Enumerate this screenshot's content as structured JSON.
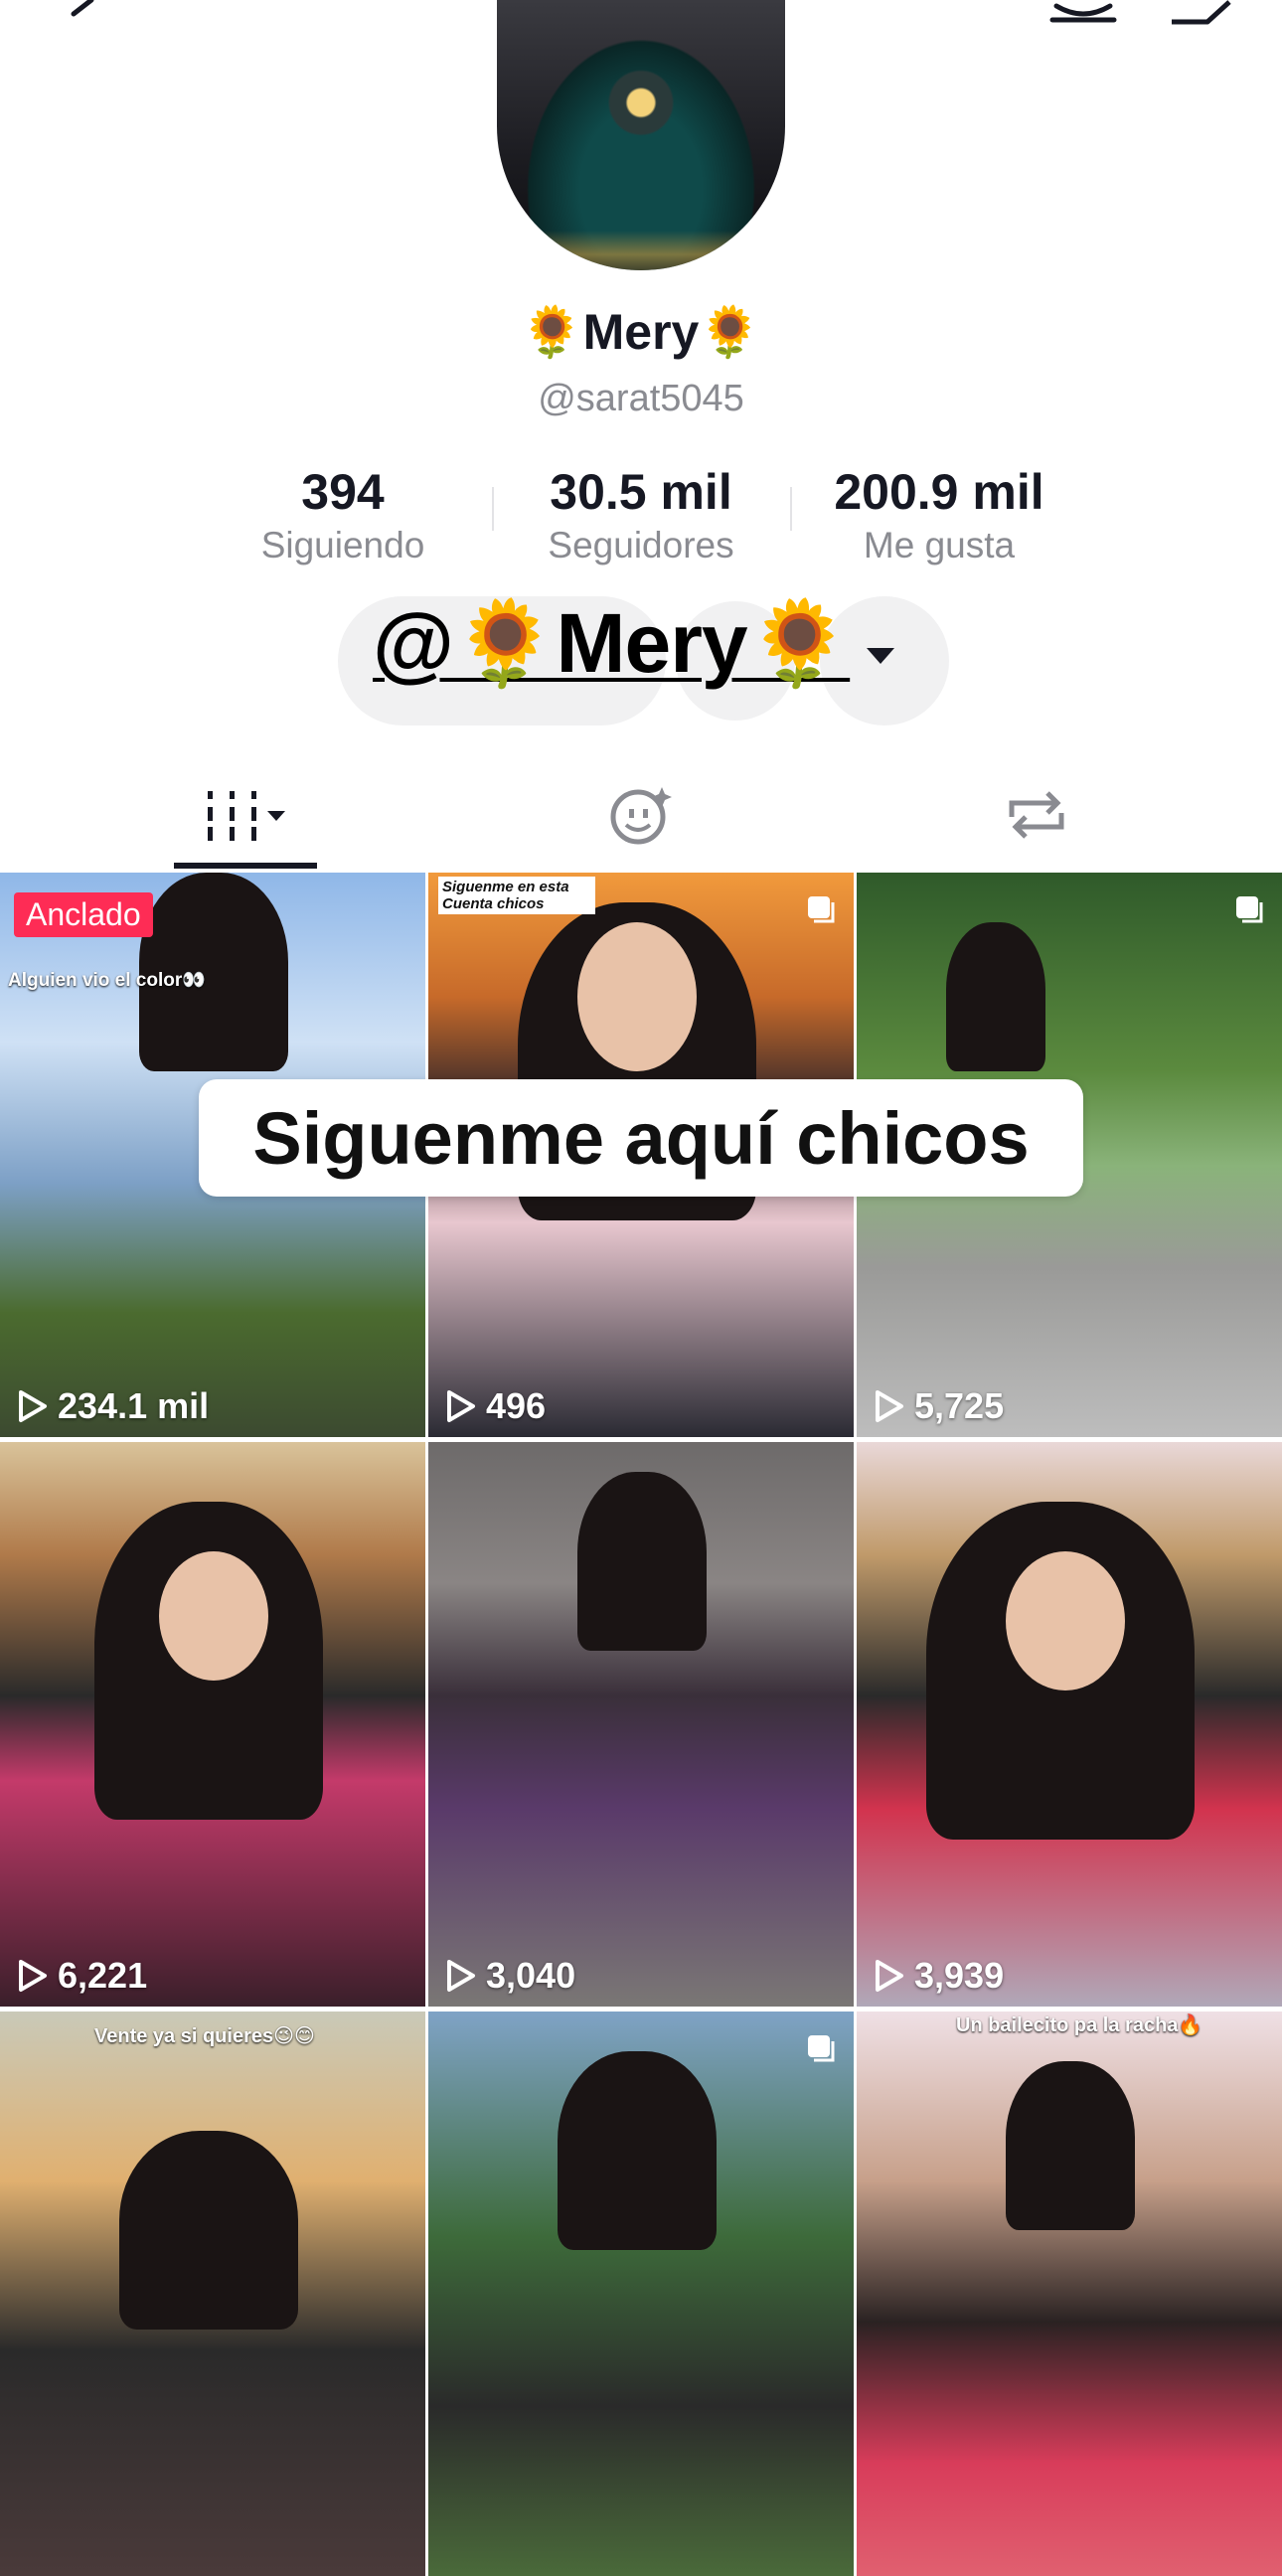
{
  "profile": {
    "display_name": "🌻Mery🌻",
    "username": "@sarat5045",
    "stats": [
      {
        "value": "394",
        "label": "Siguiendo"
      },
      {
        "value": "30.5 mil",
        "label": "Seguidores"
      },
      {
        "value": "200.9 mil",
        "label": "Me gusta"
      }
    ]
  },
  "overlay": {
    "name_banner": "@🌻Mery🌻",
    "follow_text": "Siguenme aquí chicos"
  },
  "tabs": {
    "icons": [
      "grid-icon",
      "liked-icon",
      "repost-icon"
    ],
    "active": "grid-icon"
  },
  "videos": [
    {
      "views": "234.1 mil",
      "badge": "Anclado",
      "caption": "Alguien vio el color👀"
    },
    {
      "views": "496",
      "caption": "Siguenme en esta Cuenta chicos"
    },
    {
      "views": "5,725"
    },
    {
      "views": "6,221"
    },
    {
      "views": "3,040"
    },
    {
      "views": "3,939"
    },
    {
      "views": "",
      "caption": "Vente ya si quieres😉😊"
    },
    {
      "views": ""
    },
    {
      "views": "",
      "caption": "Un bailecito pa la racha🔥"
    }
  ],
  "colors": {
    "accent": "#fe2c55",
    "text": "#161823",
    "muted": "#8a8b91"
  }
}
